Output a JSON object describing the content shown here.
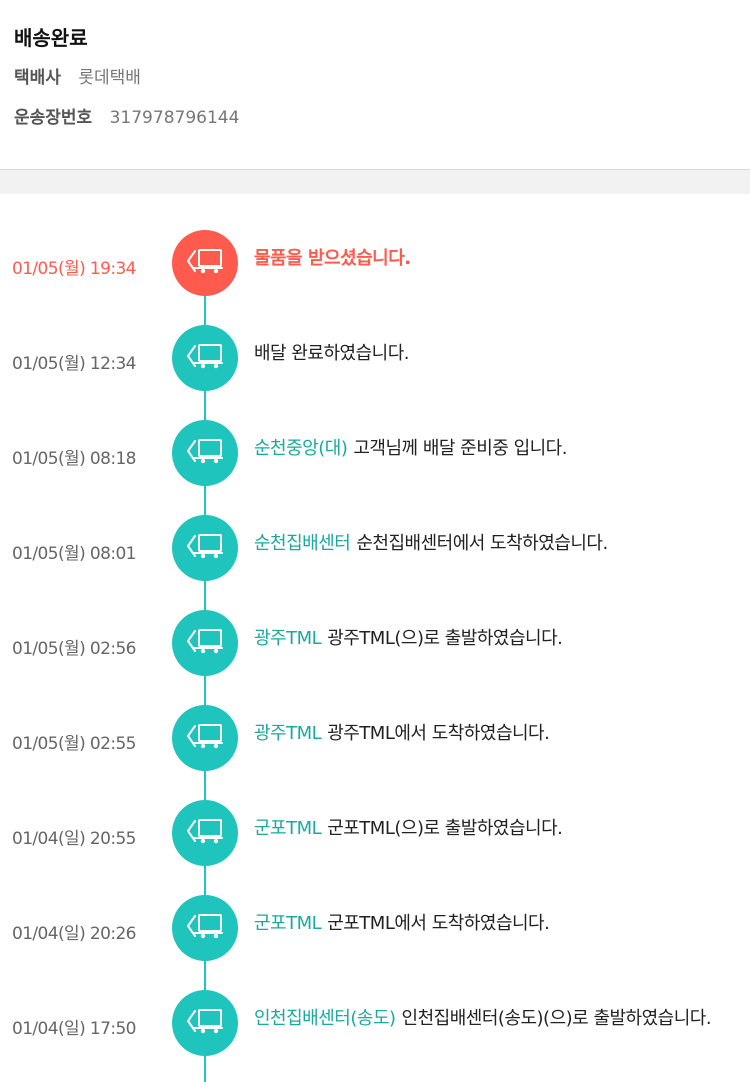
{
  "delivery": {
    "status": "배송완료",
    "courier_label": "택배사",
    "courier_value": "롯데택배",
    "tracking_label": "운송장번호",
    "tracking_value": "317978796144"
  },
  "colors": {
    "accent": "#1fc4bc",
    "current": "#ff5a4e",
    "location_text": "#1aa89f"
  },
  "timeline": [
    {
      "time": "01/05(월) 19:34",
      "location": "",
      "message": "물품을 받으셨습니다.",
      "icon": "truck-icon",
      "current": true
    },
    {
      "time": "01/05(월) 12:34",
      "location": "",
      "message": "배달 완료하였습니다.",
      "icon": "truck-icon"
    },
    {
      "time": "01/05(월) 08:18",
      "location": "순천중앙(대)",
      "message": "고객님께 배달 준비중 입니다.",
      "icon": "truck-icon"
    },
    {
      "time": "01/05(월) 08:01",
      "location": "순천집배센터",
      "message": "순천집배센터에서 도착하였습니다.",
      "icon": "truck-icon"
    },
    {
      "time": "01/05(월) 02:56",
      "location": "광주TML",
      "message": "광주TML(으)로 출발하였습니다.",
      "icon": "truck-icon"
    },
    {
      "time": "01/05(월) 02:55",
      "location": "광주TML",
      "message": "광주TML에서 도착하였습니다.",
      "icon": "truck-icon"
    },
    {
      "time": "01/04(일) 20:55",
      "location": "군포TML",
      "message": "군포TML(으)로 출발하였습니다.",
      "icon": "truck-icon"
    },
    {
      "time": "01/04(일) 20:26",
      "location": "군포TML",
      "message": "군포TML에서 도착하였습니다.",
      "icon": "truck-icon"
    },
    {
      "time": "01/04(일) 17:50",
      "location": "인천집배센터(송도)",
      "message": "인천집배센터(송도)(으)로 출발하였습니다.",
      "icon": "truck-icon"
    }
  ]
}
